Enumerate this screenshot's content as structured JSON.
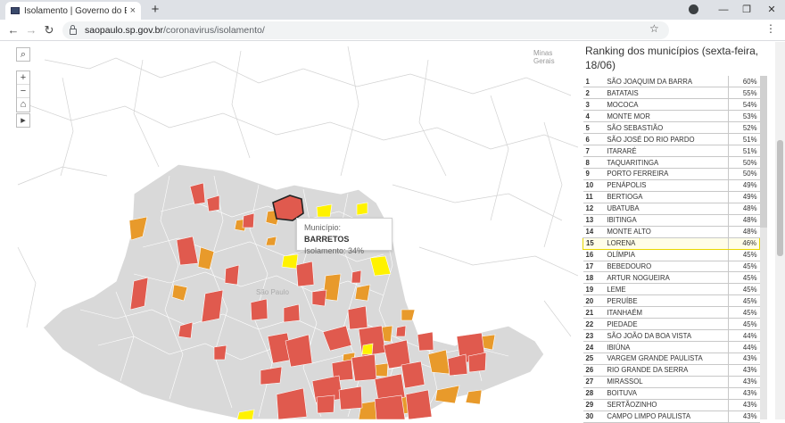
{
  "browser": {
    "tab_title": "Isolamento | Governo do Estado",
    "tab_close": "×",
    "new_tab": "+",
    "url_domain": "saopaulo.sp.gov.br",
    "url_path": "/coronavirus/isolamento/",
    "colors": {
      "tabstrip": "#dee1e6",
      "urlbar": "#f1f3f4"
    }
  },
  "map": {
    "tooltip": {
      "municipio_label": "Município:",
      "municipio_value": "BARRETOS",
      "isolamento_label": "Isolamento:",
      "isolamento_value": "34%"
    },
    "labels": {
      "minas": "Minas",
      "gerais": "Gerais",
      "sao_paulo": "São Paulo"
    },
    "controls": {
      "search": "⌕",
      "zoom_in": "+",
      "zoom_out": "−",
      "home": "⌂",
      "expand": "▸"
    },
    "colors": {
      "state_fill": "#d9d9d9",
      "red": "#e05a4e",
      "orange": "#e89a2b",
      "yellow": "#fff200"
    }
  },
  "ranking": {
    "title": "Ranking dos municípios (sexta-feira, 18/06)",
    "highlight_index": 15,
    "rows": [
      {
        "rank": "1",
        "city": "SÃO JOAQUIM DA BARRA",
        "pct": "60%"
      },
      {
        "rank": "2",
        "city": "BATATAIS",
        "pct": "55%"
      },
      {
        "rank": "3",
        "city": "MOCOCA",
        "pct": "54%"
      },
      {
        "rank": "4",
        "city": "MONTE MOR",
        "pct": "53%"
      },
      {
        "rank": "5",
        "city": "SÃO SEBASTIÃO",
        "pct": "52%"
      },
      {
        "rank": "6",
        "city": "SÃO JOSÉ DO RIO PARDO",
        "pct": "51%"
      },
      {
        "rank": "7",
        "city": "ITARARÉ",
        "pct": "51%"
      },
      {
        "rank": "8",
        "city": "TAQUARITINGA",
        "pct": "50%"
      },
      {
        "rank": "9",
        "city": "PORTO FERREIRA",
        "pct": "50%"
      },
      {
        "rank": "10",
        "city": "PENÁPOLIS",
        "pct": "49%"
      },
      {
        "rank": "11",
        "city": "BERTIOGA",
        "pct": "49%"
      },
      {
        "rank": "12",
        "city": "UBATUBA",
        "pct": "48%"
      },
      {
        "rank": "13",
        "city": "IBITINGA",
        "pct": "48%"
      },
      {
        "rank": "14",
        "city": "MONTE ALTO",
        "pct": "48%"
      },
      {
        "rank": "15",
        "city": "LORENA",
        "pct": "46%"
      },
      {
        "rank": "16",
        "city": "OLÍMPIA",
        "pct": "45%"
      },
      {
        "rank": "17",
        "city": "BEBEDOURO",
        "pct": "45%"
      },
      {
        "rank": "18",
        "city": "ARTUR NOGUEIRA",
        "pct": "45%"
      },
      {
        "rank": "19",
        "city": "LEME",
        "pct": "45%"
      },
      {
        "rank": "20",
        "city": "PERUÍBE",
        "pct": "45%"
      },
      {
        "rank": "21",
        "city": "ITANHAÉM",
        "pct": "45%"
      },
      {
        "rank": "22",
        "city": "PIEDADE",
        "pct": "45%"
      },
      {
        "rank": "23",
        "city": "SÃO JOÃO DA BOA VISTA",
        "pct": "44%"
      },
      {
        "rank": "24",
        "city": "IBIÚNA",
        "pct": "44%"
      },
      {
        "rank": "25",
        "city": "VARGEM GRANDE PAULISTA",
        "pct": "43%"
      },
      {
        "rank": "26",
        "city": "RIO GRANDE DA SERRA",
        "pct": "43%"
      },
      {
        "rank": "27",
        "city": "MIRASSOL",
        "pct": "43%"
      },
      {
        "rank": "28",
        "city": "BOITUVA",
        "pct": "43%"
      },
      {
        "rank": "29",
        "city": "SERTÃOZINHO",
        "pct": "43%"
      },
      {
        "rank": "30",
        "city": "CAMPO LIMPO PAULISTA",
        "pct": "43%"
      }
    ]
  }
}
